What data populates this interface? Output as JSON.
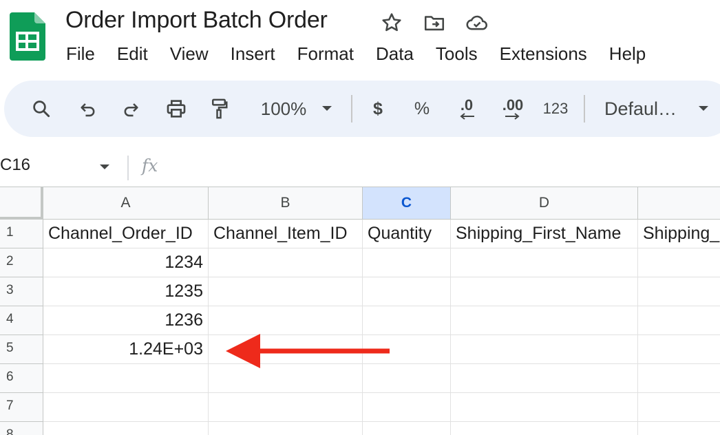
{
  "document": {
    "title": "Order Import Batch Order"
  },
  "menu": [
    "File",
    "Edit",
    "View",
    "Insert",
    "Format",
    "Data",
    "Tools",
    "Extensions",
    "Help"
  ],
  "toolbar": {
    "zoom": "100%",
    "currency": "$",
    "percent": "%",
    "decrease_decimal": ".0",
    "increase_decimal": ".00",
    "number_format": "123",
    "font": "Defaul…"
  },
  "formula_bar": {
    "cell_ref": "C16",
    "fx": "fx"
  },
  "grid": {
    "columns": [
      "A",
      "B",
      "C",
      "D"
    ],
    "selected_column": "C",
    "rows": [
      "1",
      "2",
      "3",
      "4",
      "5",
      "6",
      "7",
      "8"
    ],
    "header_row": [
      "Channel_Order_ID",
      "Channel_Item_ID",
      "Quantity",
      "Shipping_First_Name",
      "Shipping_"
    ],
    "column_a_values": [
      "1234",
      "1235",
      "1236",
      "1.24E+03"
    ]
  },
  "colors": {
    "brand_green": "#0f9d58",
    "selected_header": "#d3e3fd",
    "annotation_arrow": "#ee2a1b"
  }
}
